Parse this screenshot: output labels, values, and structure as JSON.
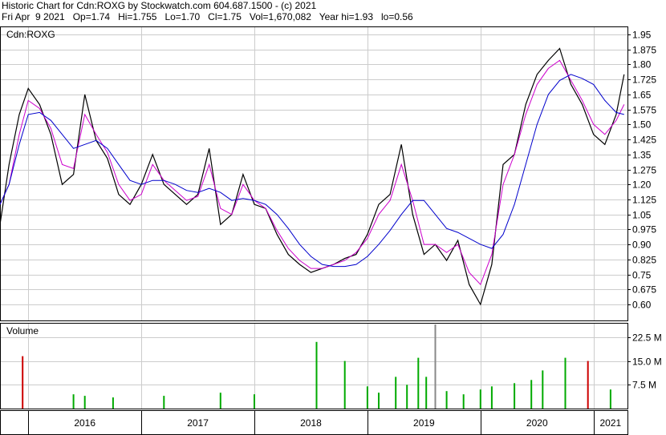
{
  "header": {
    "line1": "Historic Chart for Cdn:ROXG by Stockwatch.com 604.687.1500 - (c) 2021",
    "line2": "Fri Apr  9 2021   Op=1.74   Hi=1.755   Lo=1.70   Cl=1.75   Vol=1,670,082   Year hi=1.93   lo=0.56"
  },
  "chart_data": [
    {
      "type": "line",
      "title": "Cdn:ROXG",
      "ylim": [
        0.52,
        1.99
      ],
      "y_ticks": [
        "1.95",
        "1.875",
        "1.80",
        "1.725",
        "1.65",
        "1.575",
        "1.50",
        "1.425",
        "1.35",
        "1.275",
        "1.20",
        "1.125",
        "1.05",
        "0.975",
        "0.90",
        "0.825",
        "0.75",
        "0.675",
        "0.60"
      ],
      "x_ticks": [
        "2016",
        "2017",
        "2018",
        "2019",
        "2020",
        "2021"
      ],
      "x_tick_positions": [
        2016.0,
        2017.0,
        2018.0,
        2019.0,
        2020.0,
        2021.0
      ],
      "xlim": [
        2015.75,
        2021.3
      ],
      "grid": true,
      "series": [
        {
          "name": "",
          "color": "#000000",
          "x": [
            2015.75,
            2015.83,
            2015.92,
            2016.0,
            2016.1,
            2016.2,
            2016.3,
            2016.4,
            2016.5,
            2016.6,
            2016.7,
            2016.8,
            2016.9,
            2017.0,
            2017.1,
            2017.2,
            2017.3,
            2017.4,
            2017.5,
            2017.6,
            2017.7,
            2017.8,
            2017.9,
            2018.0,
            2018.1,
            2018.2,
            2018.3,
            2018.4,
            2018.5,
            2018.6,
            2018.7,
            2018.8,
            2018.9,
            2019.0,
            2019.1,
            2019.2,
            2019.3,
            2019.4,
            2019.5,
            2019.6,
            2019.7,
            2019.8,
            2019.9,
            2020.0,
            2020.1,
            2020.2,
            2020.3,
            2020.4,
            2020.5,
            2020.6,
            2020.7,
            2020.8,
            2020.9,
            2021.0,
            2021.1,
            2021.2,
            2021.27
          ],
          "values": [
            1.0,
            1.3,
            1.55,
            1.68,
            1.6,
            1.45,
            1.2,
            1.25,
            1.65,
            1.42,
            1.33,
            1.15,
            1.1,
            1.2,
            1.35,
            1.2,
            1.15,
            1.1,
            1.15,
            1.38,
            1.0,
            1.05,
            1.25,
            1.1,
            1.08,
            0.95,
            0.85,
            0.8,
            0.76,
            0.78,
            0.8,
            0.83,
            0.85,
            0.95,
            1.1,
            1.15,
            1.4,
            1.05,
            0.85,
            0.9,
            0.82,
            0.92,
            0.7,
            0.6,
            0.8,
            1.3,
            1.35,
            1.6,
            1.75,
            1.82,
            1.88,
            1.7,
            1.6,
            1.45,
            1.4,
            1.55,
            1.75
          ]
        },
        {
          "name": "",
          "color": "#cc00cc",
          "x": [
            2015.75,
            2015.83,
            2015.92,
            2016.0,
            2016.1,
            2016.2,
            2016.3,
            2016.4,
            2016.5,
            2016.6,
            2016.7,
            2016.8,
            2016.9,
            2017.0,
            2017.1,
            2017.2,
            2017.3,
            2017.4,
            2017.5,
            2017.6,
            2017.7,
            2017.8,
            2017.9,
            2018.0,
            2018.1,
            2018.2,
            2018.3,
            2018.4,
            2018.5,
            2018.6,
            2018.7,
            2018.8,
            2018.9,
            2019.0,
            2019.1,
            2019.2,
            2019.3,
            2019.4,
            2019.5,
            2019.6,
            2019.7,
            2019.8,
            2019.9,
            2020.0,
            2020.1,
            2020.2,
            2020.3,
            2020.4,
            2020.5,
            2020.6,
            2020.7,
            2020.8,
            2020.9,
            2021.0,
            2021.1,
            2021.2,
            2021.27
          ],
          "values": [
            1.1,
            1.2,
            1.45,
            1.62,
            1.58,
            1.48,
            1.3,
            1.28,
            1.55,
            1.45,
            1.36,
            1.2,
            1.12,
            1.15,
            1.3,
            1.22,
            1.17,
            1.12,
            1.14,
            1.3,
            1.08,
            1.05,
            1.2,
            1.12,
            1.08,
            0.97,
            0.88,
            0.82,
            0.78,
            0.78,
            0.8,
            0.82,
            0.86,
            0.93,
            1.05,
            1.12,
            1.3,
            1.12,
            0.9,
            0.9,
            0.86,
            0.9,
            0.76,
            0.7,
            0.85,
            1.2,
            1.35,
            1.55,
            1.7,
            1.78,
            1.82,
            1.72,
            1.62,
            1.5,
            1.45,
            1.52,
            1.6
          ]
        },
        {
          "name": "",
          "color": "#0000cc",
          "x": [
            2015.75,
            2015.83,
            2015.92,
            2016.0,
            2016.1,
            2016.2,
            2016.3,
            2016.4,
            2016.5,
            2016.6,
            2016.7,
            2016.8,
            2016.9,
            2017.0,
            2017.1,
            2017.2,
            2017.3,
            2017.4,
            2017.5,
            2017.6,
            2017.7,
            2017.8,
            2017.9,
            2018.0,
            2018.1,
            2018.2,
            2018.3,
            2018.4,
            2018.5,
            2018.6,
            2018.7,
            2018.8,
            2018.9,
            2019.0,
            2019.1,
            2019.2,
            2019.3,
            2019.4,
            2019.5,
            2019.6,
            2019.7,
            2019.8,
            2019.9,
            2020.0,
            2020.1,
            2020.2,
            2020.3,
            2020.4,
            2020.5,
            2020.6,
            2020.7,
            2020.8,
            2020.9,
            2021.0,
            2021.1,
            2021.2,
            2021.27
          ],
          "values": [
            1.1,
            1.2,
            1.4,
            1.55,
            1.56,
            1.52,
            1.45,
            1.38,
            1.4,
            1.42,
            1.38,
            1.3,
            1.22,
            1.2,
            1.22,
            1.22,
            1.2,
            1.17,
            1.16,
            1.18,
            1.16,
            1.12,
            1.13,
            1.12,
            1.1,
            1.05,
            0.98,
            0.9,
            0.84,
            0.8,
            0.79,
            0.79,
            0.8,
            0.84,
            0.9,
            0.97,
            1.05,
            1.12,
            1.12,
            1.05,
            0.98,
            0.96,
            0.93,
            0.9,
            0.88,
            0.95,
            1.1,
            1.3,
            1.5,
            1.65,
            1.72,
            1.75,
            1.73,
            1.7,
            1.62,
            1.56,
            1.55
          ]
        }
      ]
    },
    {
      "type": "bar",
      "title": "Volume",
      "ylim": [
        0,
        27
      ],
      "y_ticks": [
        "22.5 M",
        "15.0 M",
        "7.5 M"
      ],
      "y_tick_values": [
        22.5,
        15.0,
        7.5
      ],
      "xlim": [
        2015.75,
        2021.3
      ],
      "bar_colors": {
        "up": "#00aa00",
        "down": "#cc0000",
        "neutral": "#888888"
      },
      "series": [
        {
          "name": "",
          "x": [
            2015.95,
            2016.4,
            2016.5,
            2016.75,
            2017.2,
            2017.7,
            2018.0,
            2018.55,
            2018.8,
            2019.0,
            2019.1,
            2019.25,
            2019.35,
            2019.45,
            2019.52,
            2019.6,
            2019.7,
            2019.85,
            2020.0,
            2020.1,
            2020.3,
            2020.45,
            2020.55,
            2020.75,
            2020.95,
            2021.15
          ],
          "values": [
            16.5,
            4.5,
            4.0,
            3.5,
            4.0,
            5.0,
            4.5,
            21.0,
            15.0,
            7.0,
            5.0,
            10.0,
            7.5,
            16.0,
            10.0,
            26.5,
            5.5,
            4.5,
            6.0,
            7.0,
            8.0,
            9.0,
            12.0,
            16.0,
            15.0,
            6.0
          ],
          "colors": [
            "down",
            "up",
            "up",
            "up",
            "up",
            "up",
            "up",
            "up",
            "up",
            "up",
            "up",
            "up",
            "up",
            "up",
            "up",
            "neutral",
            "up",
            "up",
            "up",
            "up",
            "up",
            "up",
            "up",
            "up",
            "down",
            "up"
          ]
        }
      ]
    }
  ]
}
